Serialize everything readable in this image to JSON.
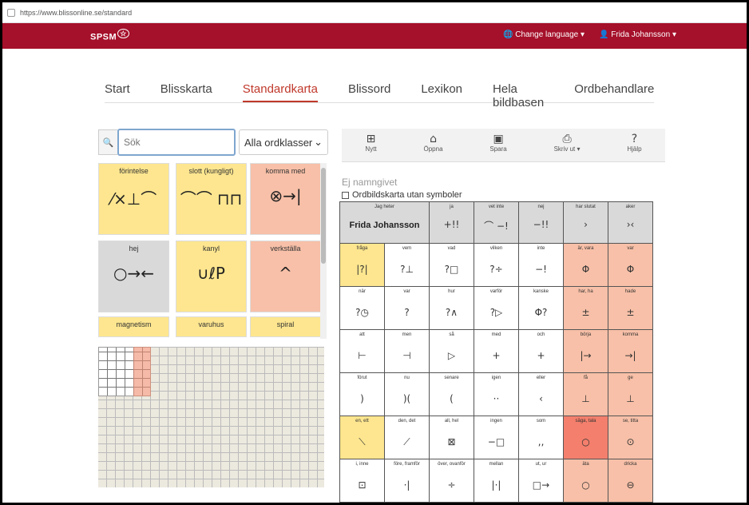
{
  "browser": {
    "url": "https://www.blissonline.se/standard"
  },
  "header": {
    "logo": "SPSM",
    "language": "Change language",
    "user": "Frida Johansson"
  },
  "nav": {
    "tabs": [
      "Start",
      "Blisskarta",
      "Standardkarta",
      "Blissord",
      "Lexikon",
      "Hela bildbasen",
      "Ordbehandlare"
    ],
    "active": "Standardkarta"
  },
  "search": {
    "placeholder": "Sök",
    "wordclass": "Alla ordklasser"
  },
  "cards": [
    {
      "label": "förintelse",
      "symbol": "⁄×⊥⌒",
      "color": "yellow"
    },
    {
      "label": "slott (kungligt)",
      "symbol": "⌒⌒ ⊓⊓",
      "color": "yellow"
    },
    {
      "label": "komma med",
      "symbol": "⊗→|",
      "color": "pink"
    },
    {
      "label": "hej",
      "symbol": "○→←",
      "color": "gray"
    },
    {
      "label": "kanyl",
      "symbol": "∪ℓP",
      "color": "yellow"
    },
    {
      "label": "verkställa",
      "symbol": "^",
      "color": "pink"
    },
    {
      "label": "magnetism",
      "symbol": "",
      "color": "yellow"
    },
    {
      "label": "varuhus",
      "symbol": "",
      "color": "yellow"
    },
    {
      "label": "spiral",
      "symbol": "",
      "color": "yellow"
    }
  ],
  "toolbar": [
    {
      "label": "Nytt",
      "icon": "⊞"
    },
    {
      "label": "Öppna",
      "icon": "⌂"
    },
    {
      "label": "Spara",
      "icon": "▣"
    },
    {
      "label": "Skriv ut ▾",
      "icon": "⎙"
    },
    {
      "label": "Hjälp",
      "icon": "?"
    }
  ],
  "chart": {
    "title": "Ej namngivet",
    "checkbox": "Ordbildskarta utan symboler"
  },
  "grid": {
    "header": [
      {
        "label": "Jag heter",
        "name": "Frida Johansson",
        "symbol": ""
      },
      {
        "label": "ja",
        "symbol": "+!!"
      },
      {
        "label": "vet inte",
        "symbol": "⌒ −!"
      },
      {
        "label": "nej",
        "symbol": "−!!"
      },
      {
        "label": "har slutat",
        "symbol": "›"
      },
      {
        "label": "aker",
        "symbol": "›‹"
      }
    ],
    "rows": [
      [
        {
          "l": "fråga",
          "s": "|?|",
          "c": "yellow"
        },
        {
          "l": "vem",
          "s": "?⊥",
          "c": ""
        },
        {
          "l": "vad",
          "s": "?□",
          "c": ""
        },
        {
          "l": "vilken",
          "s": "?÷",
          "c": ""
        },
        {
          "l": "inte",
          "s": "−!",
          "c": ""
        },
        {
          "l": "är, vara",
          "s": "Φ",
          "c": "pk"
        },
        {
          "l": "var",
          "s": "Φ",
          "c": "pk"
        }
      ],
      [
        {
          "l": "när",
          "s": "?◷",
          "c": ""
        },
        {
          "l": "var",
          "s": "?",
          "c": ""
        },
        {
          "l": "hur",
          "s": "?∧",
          "c": ""
        },
        {
          "l": "varför",
          "s": "?▷",
          "c": ""
        },
        {
          "l": "kanske",
          "s": "Φ?",
          "c": ""
        },
        {
          "l": "har, ha",
          "s": "±",
          "c": "pk"
        },
        {
          "l": "hade",
          "s": "±",
          "c": "pk"
        }
      ],
      [
        {
          "l": "att",
          "s": "⊢",
          "c": ""
        },
        {
          "l": "men",
          "s": "⊣",
          "c": ""
        },
        {
          "l": "så",
          "s": "▷",
          "c": ""
        },
        {
          "l": "med",
          "s": "+",
          "c": ""
        },
        {
          "l": "och",
          "s": "+",
          "c": ""
        },
        {
          "l": "börja",
          "s": "|→",
          "c": "pk"
        },
        {
          "l": "komma",
          "s": "→|",
          "c": "pk"
        }
      ],
      [
        {
          "l": "förut",
          "s": ")",
          "c": ""
        },
        {
          "l": "nu",
          "s": ")(",
          "c": ""
        },
        {
          "l": "senare",
          "s": "(",
          "c": ""
        },
        {
          "l": "igen",
          "s": "··",
          "c": ""
        },
        {
          "l": "eller",
          "s": "‹",
          "c": ""
        },
        {
          "l": "få",
          "s": "⊥",
          "c": "pk"
        },
        {
          "l": "ge",
          "s": "⊥",
          "c": "pk"
        }
      ],
      [
        {
          "l": "en, ett",
          "s": "⟍",
          "c": "yellow"
        },
        {
          "l": "den, det",
          "s": "⟋",
          "c": ""
        },
        {
          "l": "all, hel",
          "s": "⊠",
          "c": ""
        },
        {
          "l": "ingen",
          "s": "−□",
          "c": ""
        },
        {
          "l": "som",
          "s": "‚‚",
          "c": ""
        },
        {
          "l": "säga, tala",
          "s": "○",
          "c": "rd"
        },
        {
          "l": "se, titta",
          "s": "⊙",
          "c": "pk"
        }
      ],
      [
        {
          "l": "i, inne",
          "s": "⊡",
          "c": ""
        },
        {
          "l": "före, framför",
          "s": "·|",
          "c": ""
        },
        {
          "l": "över, ovanför",
          "s": "÷",
          "c": ""
        },
        {
          "l": "mellan",
          "s": "|·|",
          "c": ""
        },
        {
          "l": "ut, ur",
          "s": "□→",
          "c": ""
        },
        {
          "l": "äta",
          "s": "○",
          "c": "pk"
        },
        {
          "l": "dricka",
          "s": "⊖",
          "c": "pk"
        }
      ]
    ]
  },
  "colors": {
    "brand": "#a5102a",
    "active_tab": "#c0392b",
    "yellow": "#fde68f",
    "pink": "#f8c0a8",
    "red": "#f37f6c"
  }
}
